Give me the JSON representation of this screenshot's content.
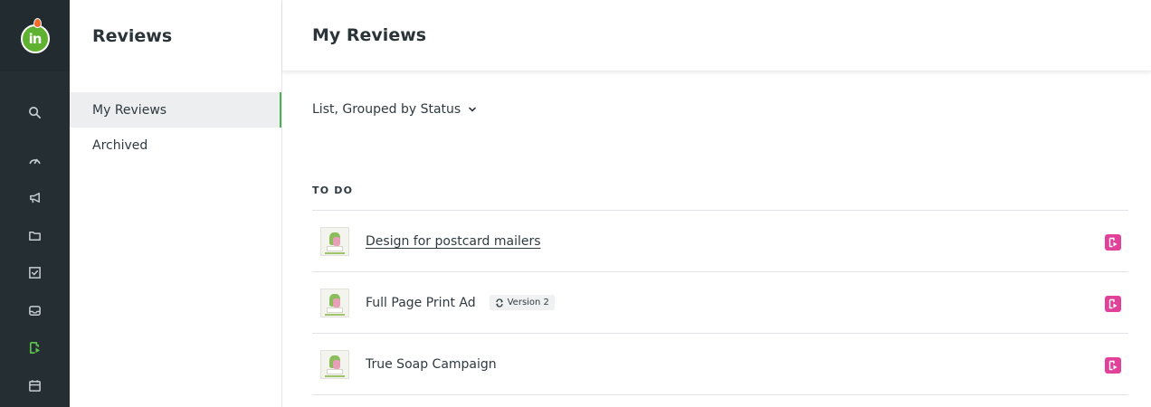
{
  "app": {
    "logo_text": "in",
    "colors": {
      "rail": "#252f33",
      "accent": "#4cb050",
      "action": "#e0419a"
    }
  },
  "rail": {
    "items": [
      {
        "icon": "search-icon"
      },
      {
        "icon": "dashboard-icon"
      },
      {
        "icon": "megaphone-icon"
      },
      {
        "icon": "folder-icon"
      },
      {
        "icon": "checkbox-icon"
      },
      {
        "icon": "inbox-icon"
      },
      {
        "icon": "review-icon",
        "active": true
      },
      {
        "icon": "calendar-icon"
      }
    ]
  },
  "sidebar": {
    "title": "Reviews",
    "items": [
      {
        "label": "My Reviews",
        "active": true
      },
      {
        "label": "Archived"
      }
    ]
  },
  "main": {
    "title": "My Reviews",
    "view_selector": "List, Grouped by Status",
    "group": {
      "label": "TO DO",
      "rows": [
        {
          "title": "Design for postcard mailers",
          "link": true,
          "action_icon": "review-icon"
        },
        {
          "title": "Full Page Print Ad",
          "version": "Version 2",
          "action_icon": "review-icon"
        },
        {
          "title": "True Soap Campaign",
          "action_icon": "review-icon"
        }
      ]
    }
  }
}
